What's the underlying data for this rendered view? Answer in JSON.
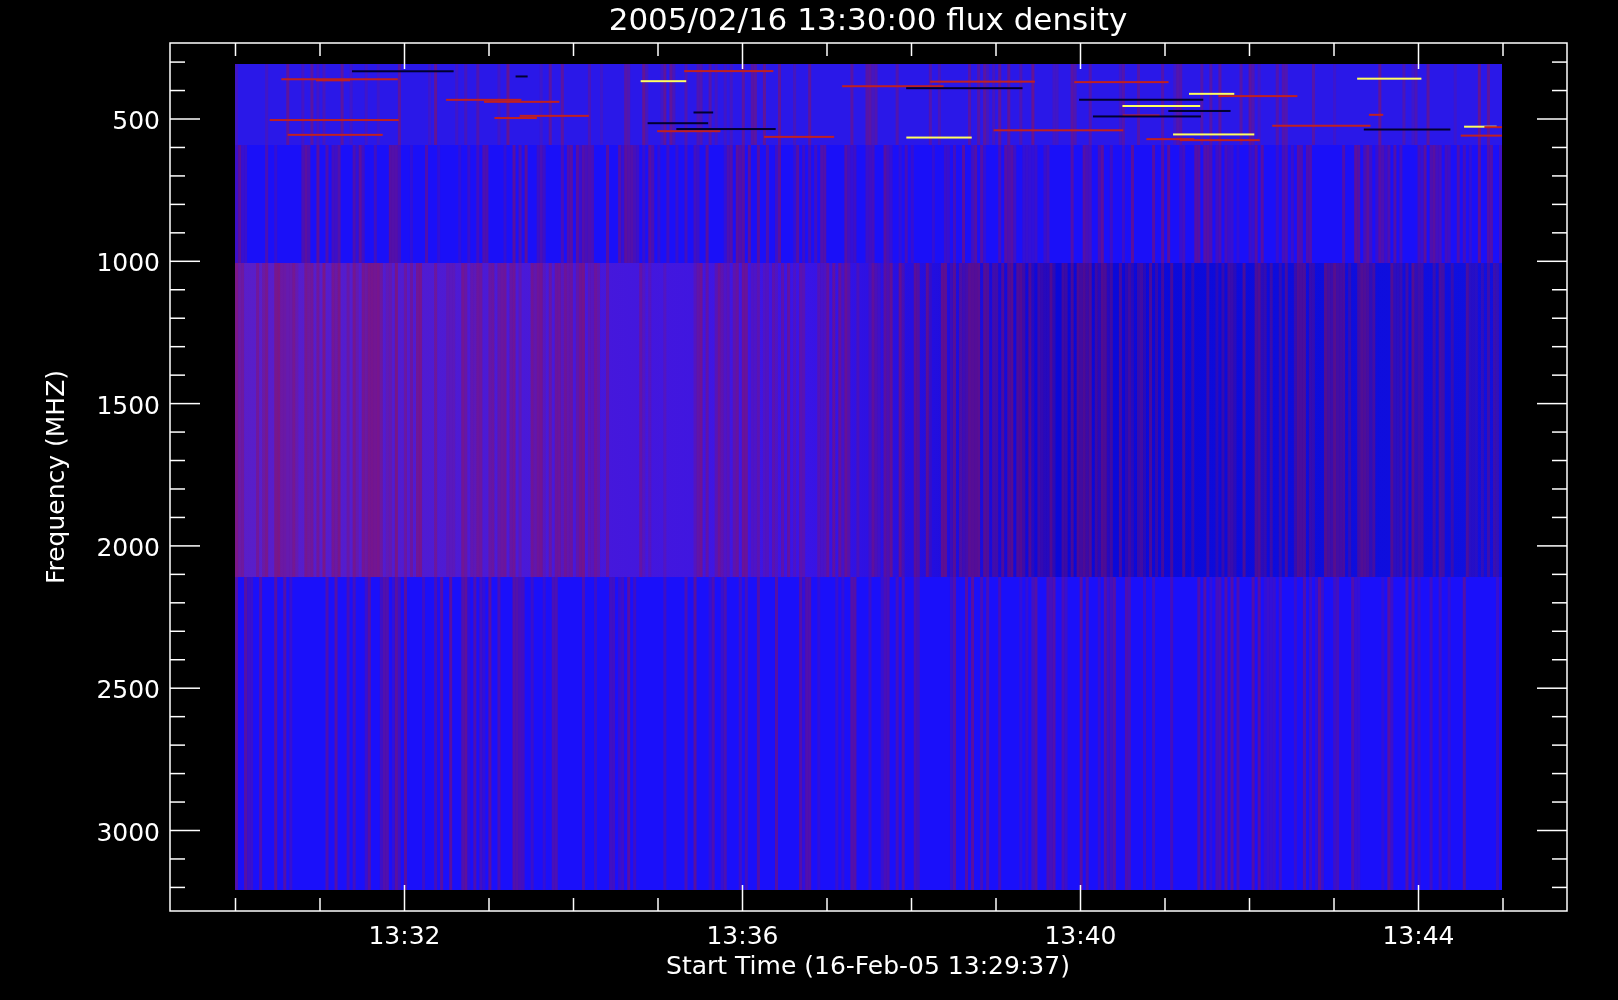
{
  "plot": {
    "title": "2005/02/16 13:30:00 flux density",
    "xlabel": "Start Time (16-Feb-05 13:29:37)",
    "ylabel": "Frequency (MHZ)",
    "yticks": [
      "500",
      "1000",
      "1500",
      "2000",
      "2500",
      "3000"
    ],
    "xticks": [
      "13:32",
      "13:36",
      "13:40",
      "13:44"
    ]
  }
}
